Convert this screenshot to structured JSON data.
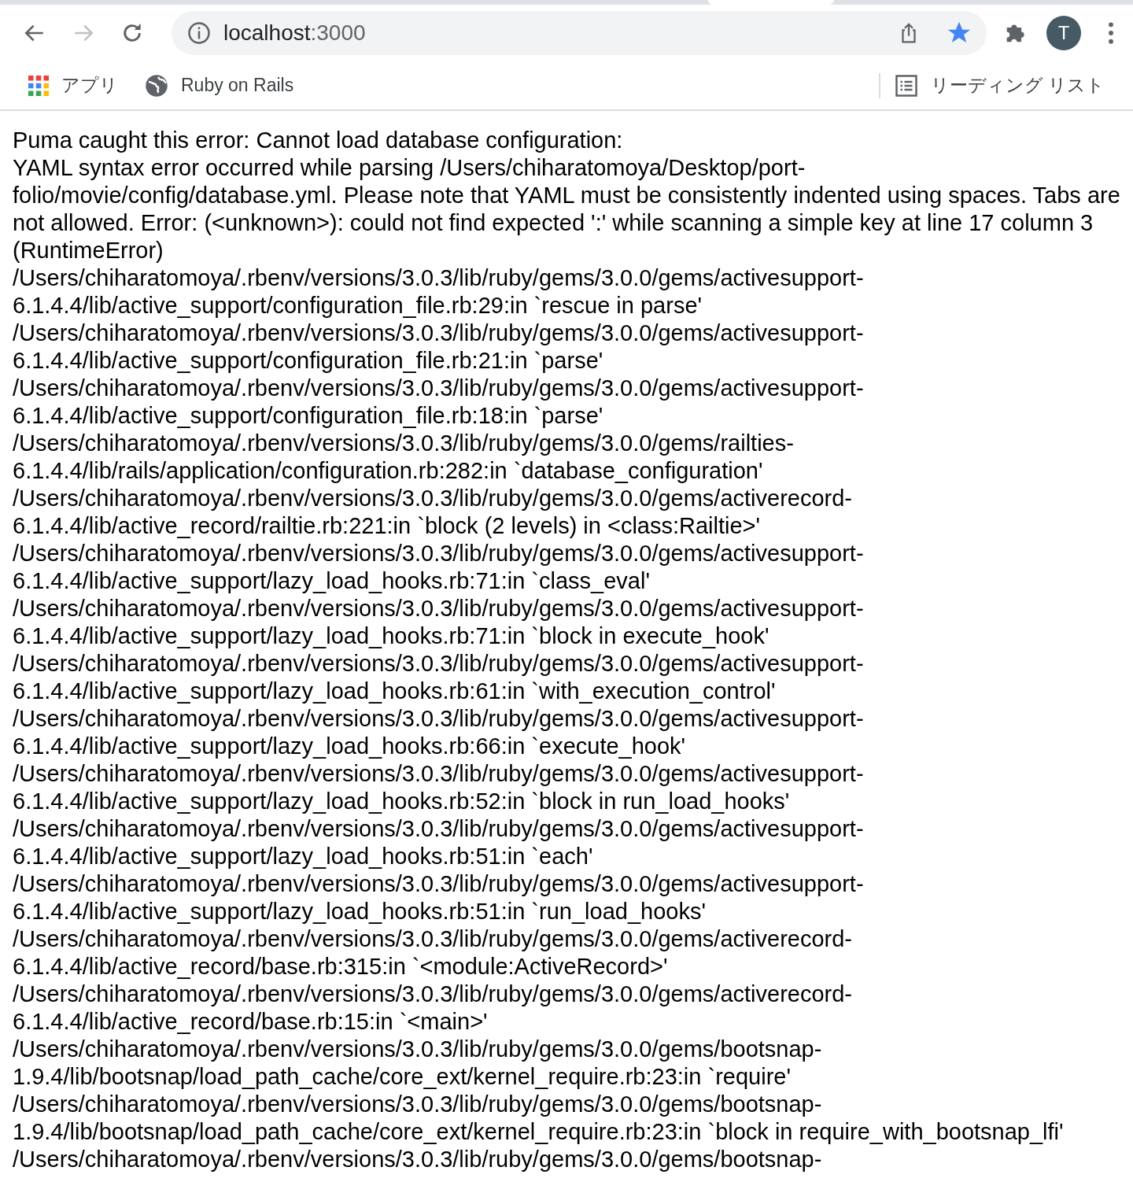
{
  "browser": {
    "forward_disabled": true,
    "url_host": "localhost",
    "url_port": ":3000",
    "bookmarked": true,
    "profile_initial": "T",
    "bookmarks": [
      {
        "kind": "apps",
        "label": "アプリ"
      },
      {
        "kind": "globe",
        "label": "Ruby on Rails"
      }
    ],
    "reading_list": "リーディング リスト"
  },
  "page": {
    "heading": "Puma caught this error: Cannot load database configuration:",
    "detail": "YAML syntax error occurred while parsing /Users/chiharatomoya/Desktop/port-folio/movie/config/database.yml. Please note that YAML must be consistently indented using spaces. Tabs are not allowed. Error: (<unknown>): could not find expected ':' while scanning a simple key at line 17 column 3 (RuntimeError)",
    "backtrace": [
      "/Users/chiharatomoya/.rbenv/versions/3.0.3/lib/ruby/gems/3.0.0/gems/activesupport-6.1.4.4/lib/active_support/configuration_file.rb:29:in `rescue in parse'",
      "/Users/chiharatomoya/.rbenv/versions/3.0.3/lib/ruby/gems/3.0.0/gems/activesupport-6.1.4.4/lib/active_support/configuration_file.rb:21:in `parse'",
      "/Users/chiharatomoya/.rbenv/versions/3.0.3/lib/ruby/gems/3.0.0/gems/activesupport-6.1.4.4/lib/active_support/configuration_file.rb:18:in `parse'",
      "/Users/chiharatomoya/.rbenv/versions/3.0.3/lib/ruby/gems/3.0.0/gems/railties-6.1.4.4/lib/rails/application/configuration.rb:282:in `database_configuration'",
      "/Users/chiharatomoya/.rbenv/versions/3.0.3/lib/ruby/gems/3.0.0/gems/activerecord-6.1.4.4/lib/active_record/railtie.rb:221:in `block (2 levels) in <class:Railtie>'",
      "/Users/chiharatomoya/.rbenv/versions/3.0.3/lib/ruby/gems/3.0.0/gems/activesupport-6.1.4.4/lib/active_support/lazy_load_hooks.rb:71:in `class_eval'",
      "/Users/chiharatomoya/.rbenv/versions/3.0.3/lib/ruby/gems/3.0.0/gems/activesupport-6.1.4.4/lib/active_support/lazy_load_hooks.rb:71:in `block in execute_hook'",
      "/Users/chiharatomoya/.rbenv/versions/3.0.3/lib/ruby/gems/3.0.0/gems/activesupport-6.1.4.4/lib/active_support/lazy_load_hooks.rb:61:in `with_execution_control'",
      "/Users/chiharatomoya/.rbenv/versions/3.0.3/lib/ruby/gems/3.0.0/gems/activesupport-6.1.4.4/lib/active_support/lazy_load_hooks.rb:66:in `execute_hook'",
      "/Users/chiharatomoya/.rbenv/versions/3.0.3/lib/ruby/gems/3.0.0/gems/activesupport-6.1.4.4/lib/active_support/lazy_load_hooks.rb:52:in `block in run_load_hooks'",
      "/Users/chiharatomoya/.rbenv/versions/3.0.3/lib/ruby/gems/3.0.0/gems/activesupport-6.1.4.4/lib/active_support/lazy_load_hooks.rb:51:in `each'",
      "/Users/chiharatomoya/.rbenv/versions/3.0.3/lib/ruby/gems/3.0.0/gems/activesupport-6.1.4.4/lib/active_support/lazy_load_hooks.rb:51:in `run_load_hooks'",
      "/Users/chiharatomoya/.rbenv/versions/3.0.3/lib/ruby/gems/3.0.0/gems/activerecord-6.1.4.4/lib/active_record/base.rb:315:in `<module:ActiveRecord>'",
      "/Users/chiharatomoya/.rbenv/versions/3.0.3/lib/ruby/gems/3.0.0/gems/activerecord-6.1.4.4/lib/active_record/base.rb:15:in `<main>'",
      "/Users/chiharatomoya/.rbenv/versions/3.0.3/lib/ruby/gems/3.0.0/gems/bootsnap-1.9.4/lib/bootsnap/load_path_cache/core_ext/kernel_require.rb:23:in `require'",
      "/Users/chiharatomoya/.rbenv/versions/3.0.3/lib/ruby/gems/3.0.0/gems/bootsnap-1.9.4/lib/bootsnap/load_path_cache/core_ext/kernel_require.rb:23:in `block in require_with_bootsnap_lfi'",
      "/Users/chiharatomoya/.rbenv/versions/3.0.3/lib/ruby/gems/3.0.0/gems/bootsnap-"
    ]
  }
}
